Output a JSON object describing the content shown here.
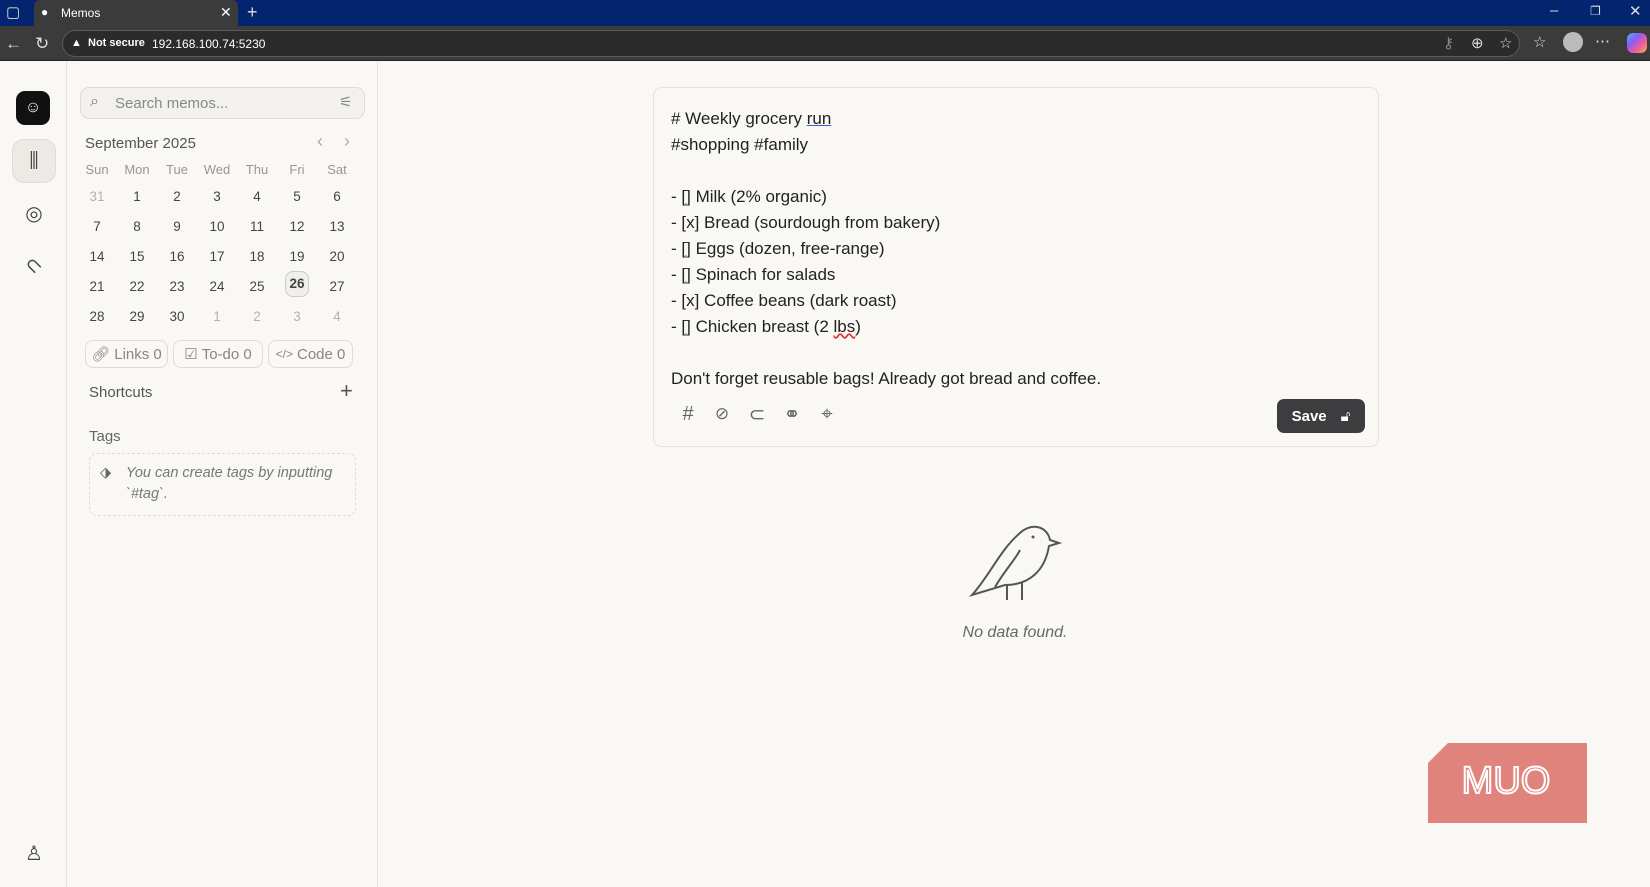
{
  "browser": {
    "tab_title": "Memos",
    "security": "Not secure",
    "url": "192.168.100.74:5230"
  },
  "sidebar": {
    "search_placeholder": "Search memos...",
    "calendar": {
      "month": "September 2025",
      "weekdays": [
        "Sun",
        "Mon",
        "Tue",
        "Wed",
        "Thu",
        "Fri",
        "Sat"
      ],
      "weeks": [
        [
          "31",
          "1",
          "2",
          "3",
          "4",
          "5",
          "6"
        ],
        [
          "7",
          "8",
          "9",
          "10",
          "11",
          "12",
          "13"
        ],
        [
          "14",
          "15",
          "16",
          "17",
          "18",
          "19",
          "20"
        ],
        [
          "21",
          "22",
          "23",
          "24",
          "25",
          "26",
          "27"
        ],
        [
          "28",
          "29",
          "30",
          "1",
          "2",
          "3",
          "4"
        ]
      ],
      "today": "26"
    },
    "stats": {
      "links": "Links 0",
      "todo": "To-do 0",
      "code": "Code 0"
    },
    "shortcuts_label": "Shortcuts",
    "tags_label": "Tags",
    "tags_hint": "You can create tags by inputting `#tag`."
  },
  "editor": {
    "lines": [
      "# Weekly grocery run",
      "#shopping #family",
      "",
      "- [] Milk (2% organic)",
      "- [x] Bread (sourdough from bakery)",
      "- [] Eggs (dozen, free-range)",
      "- [] Spinach for salads",
      "- [x] Coffee beans (dark roast)",
      "- [] Chicken breast (2 lbs)",
      "",
      "Don't forget reusable bags! Already got bread and coffee."
    ],
    "save_label": "Save"
  },
  "empty": {
    "message": "No data found."
  },
  "watermark": "MUO"
}
